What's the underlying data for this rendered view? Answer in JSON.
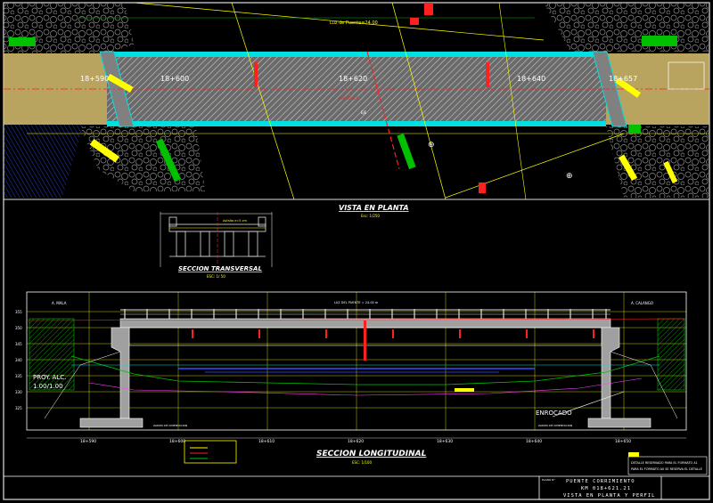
{
  "plan": {
    "span_label": "Luz de Puente=24.00",
    "stations": [
      "18+590",
      "18+600",
      "18+620",
      "18+640",
      "18+657"
    ],
    "deck_marks": [
      "ANCHO 8.0",
      "EJE"
    ],
    "title": "VISTA EN PLANTA",
    "scale": "Esc: 1/250"
  },
  "cross_section": {
    "title": "SECCION TRANSVERSAL",
    "scale": "ESC: 1/ 50",
    "note": "Asfalto e=5 cm"
  },
  "elevation": {
    "left_label": "A. MALA",
    "right_label": "A. CALANGO",
    "deck_label": "LUZ DEL PUENTE = 24.00 m",
    "left_note": "PROY. ALC.",
    "left_scale": "1.00/1.00",
    "right_note": "ENROCADO",
    "level_marks": [
      "355",
      "350",
      "345",
      "340",
      "335",
      "330",
      "325"
    ],
    "stations": [
      "18+590",
      "18+600",
      "18+610",
      "18+620",
      "18+630",
      "18+640",
      "18+650"
    ],
    "title": "SECCION LONGITUDINAL",
    "scale": "ESC: 1/100",
    "left_foot": "ZAPATA DE CIMENTACION",
    "right_foot": "ZAPATA DE CIMENTACION"
  },
  "notes": {
    "line1": "DETALLE   RESERVADO PARA EL FORMATO A1",
    "line2": "PARA EL FORMATO A0 SE RESERVA EL DETALLE"
  },
  "title_block": {
    "plano_label": "PLANO N°",
    "line1": "PUENTE CORRIMIENTO",
    "line2": "KM 018+621.21",
    "line3": "VISTA EN PLANTA Y PERFIL"
  },
  "colors": {
    "background": "#000000",
    "frame": "#e0e0e0",
    "road": "#d8c070",
    "deck": "#9a9a9a",
    "yellow": "#ffff00",
    "cyan": "#00ffff",
    "green": "#00c000",
    "red": "#ff2020",
    "blue": "#2040ff",
    "magenta": "#ff40ff"
  }
}
